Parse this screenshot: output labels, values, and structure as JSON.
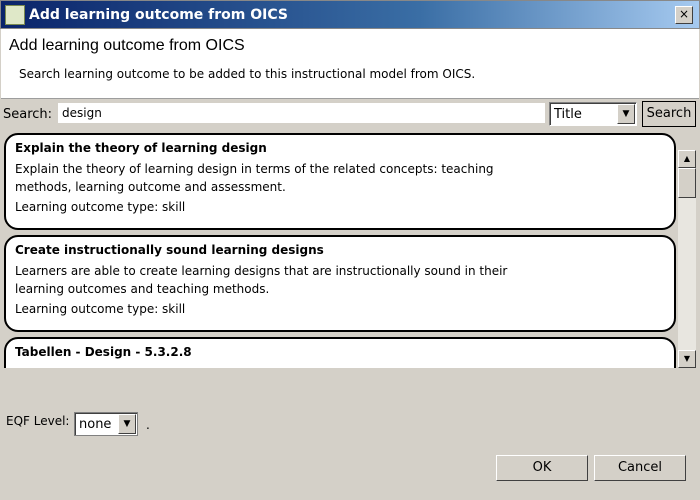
{
  "window": {
    "title": "Add learning outcome from OICS",
    "close": "×"
  },
  "header": {
    "title": "Add learning outcome from OICS",
    "description": "Search learning outcome to be added to this instructional model from OICS."
  },
  "search": {
    "label": "Search:",
    "value": "design",
    "field": "Title",
    "button": "Search"
  },
  "results": [
    {
      "title": "Explain the theory of learning design",
      "description": "Explain the theory of learning design in terms of the related concepts: teaching methods, learning outcome and assessment.",
      "type": "Learning outcome type: skill"
    },
    {
      "title": "Create instructionally sound learning designs",
      "description": "Learners are able to create learning designs that are instructionally sound in their learning outcomes and teaching methods.",
      "type": "Learning outcome type: skill"
    },
    {
      "title": "Tabellen - Design - 5.3.2.8"
    }
  ],
  "eqf": {
    "label": "EQF Level:",
    "value": "none",
    "suffix": "."
  },
  "buttons": {
    "ok": "OK",
    "cancel": "Cancel"
  }
}
